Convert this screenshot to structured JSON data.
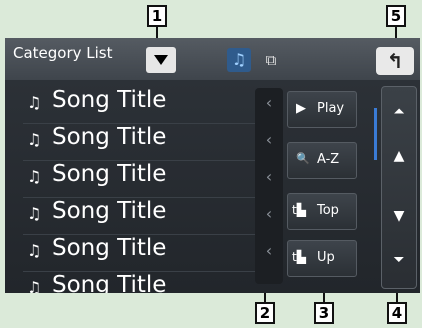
{
  "header": {
    "title": "Category List",
    "dropdown_icon": "triangle-down-icon",
    "tabs": [
      {
        "name": "music",
        "icon": "music-note-icon",
        "glyph": "♫",
        "active": true
      },
      {
        "name": "video",
        "icon": "film-icon",
        "glyph": "⧉",
        "active": false
      }
    ],
    "back_glyph": "↰"
  },
  "list": {
    "note_glyph": "♫",
    "items": [
      {
        "label": "Song Title"
      },
      {
        "label": "Song Title"
      },
      {
        "label": "Song Title"
      },
      {
        "label": "Song Title"
      },
      {
        "label": "Song Title"
      },
      {
        "label": "Song Title"
      }
    ],
    "chevron_glyph": "‹"
  },
  "actions": [
    {
      "label": "Play",
      "icon": "play-icon",
      "glyph": "▶"
    },
    {
      "label": "A-Z",
      "icon": "search-icon",
      "glyph": "🔍"
    },
    {
      "label": "Top",
      "icon": "folder-top-icon",
      "glyph": "t▙"
    },
    {
      "label": "Up",
      "icon": "folder-up-icon",
      "glyph": "t▙"
    }
  ],
  "scroll": {
    "top_glyph": "⏶",
    "up_glyph": "▲",
    "down_glyph": "▼",
    "bottom_glyph": "⏷"
  },
  "callouts": [
    "1",
    "2",
    "3",
    "4",
    "5"
  ],
  "colors": {
    "accent": "#3a7bd5",
    "background": "#dbead9",
    "screen": "#23272c"
  }
}
